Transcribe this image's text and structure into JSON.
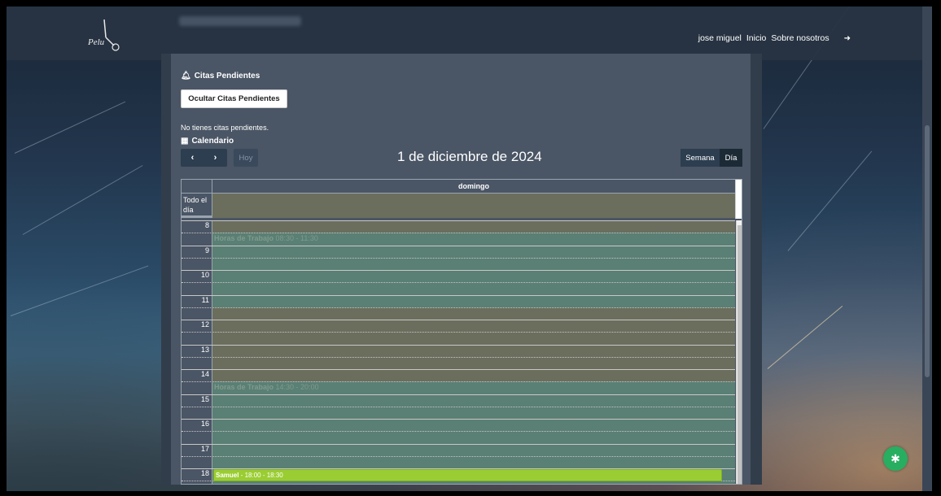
{
  "navbar": {
    "logo_text": "Pelu",
    "user_name": "jose miguel",
    "links": [
      "Inicio",
      "Sobre nosotros"
    ]
  },
  "pending": {
    "title": "Citas Pendientes",
    "toggle_button": "Ocultar Citas Pendientes",
    "empty_message": "No tienes citas pendientes."
  },
  "calendar": {
    "section_title": "Calendario",
    "today_button": "Hoy",
    "title": "1 de diciembre de 2024",
    "views": [
      "Semana",
      "Día"
    ],
    "active_view": "Día",
    "day_header": "domingo",
    "all_day_label": "Todo el día",
    "hours": [
      "8",
      "9",
      "10",
      "11",
      "12",
      "13",
      "14",
      "15",
      "16",
      "17",
      "18"
    ],
    "background_events": [
      {
        "title": "Horas de Trabajo",
        "time": "08:30 - 11:30"
      },
      {
        "title": "Horas de Trabajo",
        "time": "14:30 - 20:00"
      }
    ],
    "event": {
      "title": "Samuel",
      "time": "18:00 - 18:30"
    }
  },
  "colors": {
    "work_hours": "#5a7f74",
    "off_hours": "#6b6e5d",
    "event": "#9acd32",
    "fab": "#27ae60"
  }
}
